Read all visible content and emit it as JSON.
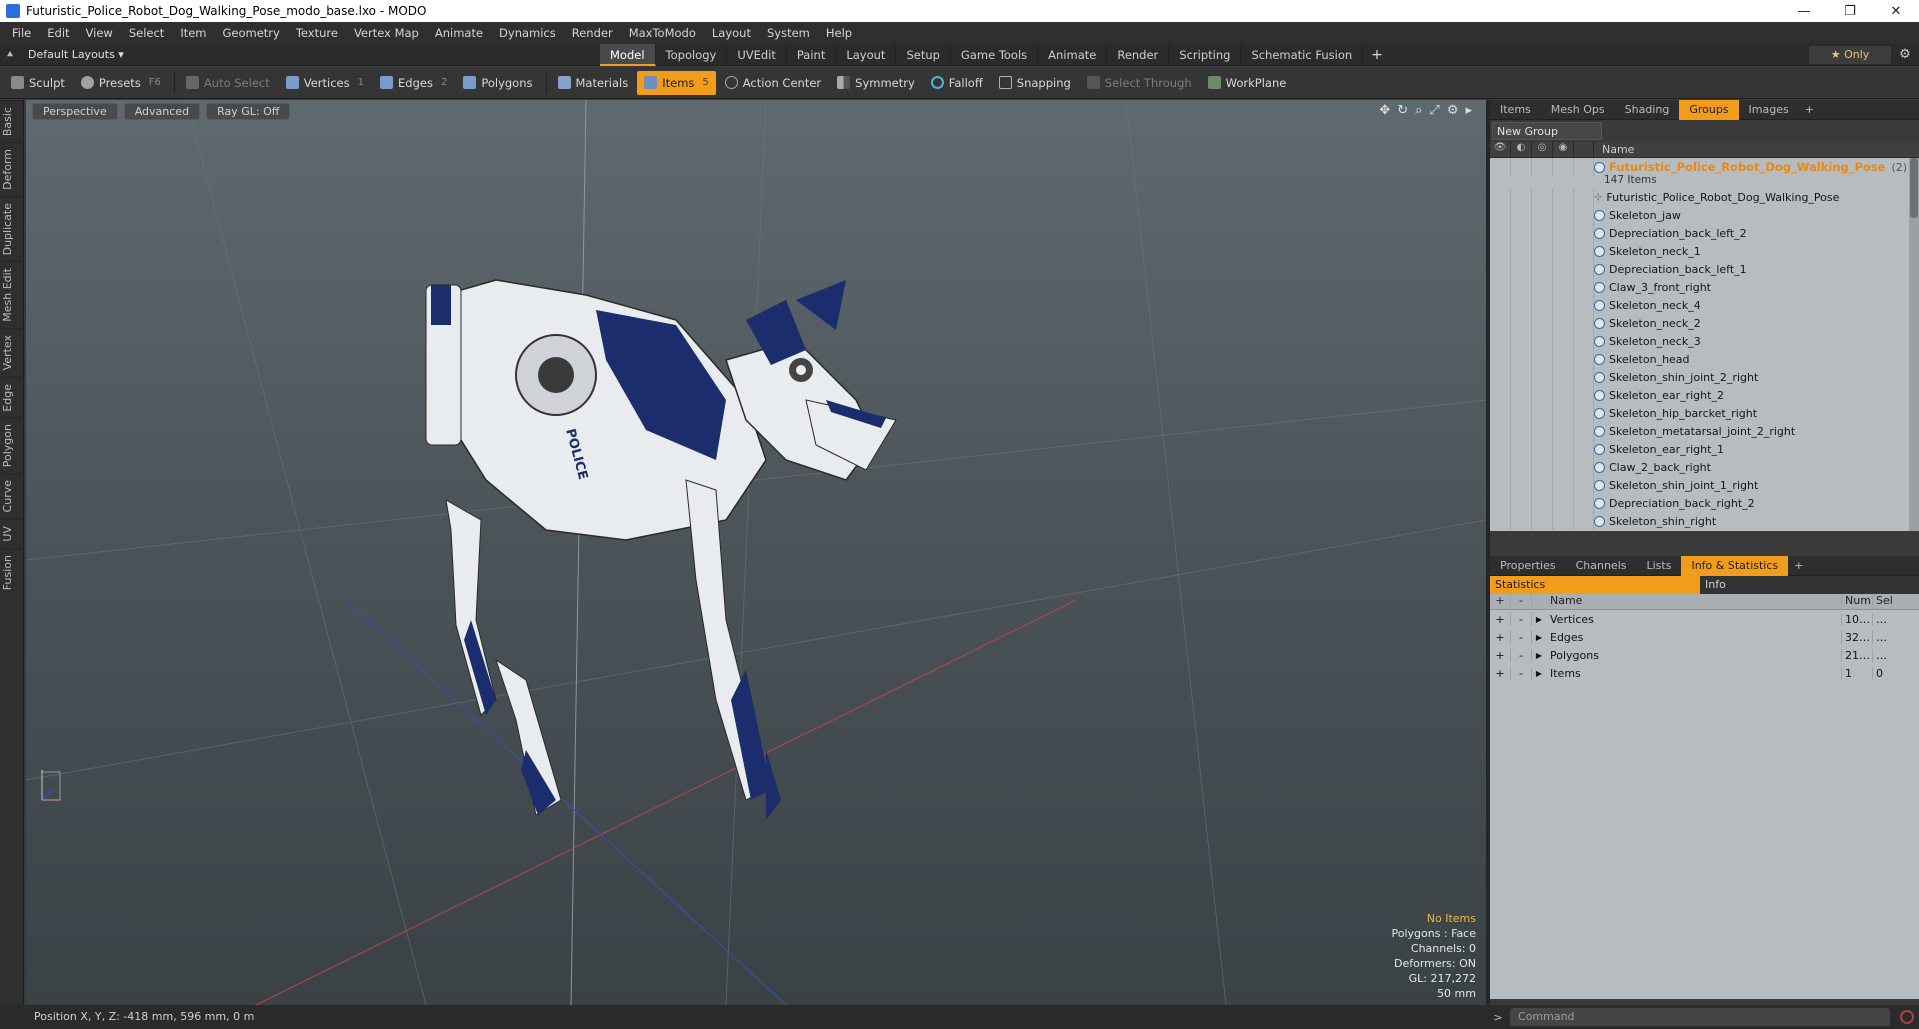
{
  "window": {
    "title": "Futuristic_Police_Robot_Dog_Walking_Pose_modo_base.lxo - MODO",
    "minimize": "—",
    "maximize": "❐",
    "close": "✕"
  },
  "menu": [
    "File",
    "Edit",
    "View",
    "Select",
    "Item",
    "Geometry",
    "Texture",
    "Vertex Map",
    "Animate",
    "Dynamics",
    "Render",
    "MaxToModo",
    "Layout",
    "System",
    "Help"
  ],
  "layout": {
    "selector": "Default Layouts ▾",
    "tabs": [
      "Model",
      "Topology",
      "UVEdit",
      "Paint",
      "Layout",
      "Setup",
      "Game Tools",
      "Animate",
      "Render",
      "Scripting",
      "Schematic Fusion"
    ],
    "active_tab": "Model",
    "plus": "+",
    "only_label": "★  Only",
    "gear": "⚙"
  },
  "toolbar": {
    "sculpt": "Sculpt",
    "presets": "Presets",
    "presets_key": "F6",
    "auto_select": "Auto Select",
    "vertices": "Vertices",
    "vertices_key": "1",
    "edges": "Edges",
    "edges_key": "2",
    "polygons": "Polygons",
    "materials": "Materials",
    "items": "Items",
    "items_key": "5",
    "action_center": "Action Center",
    "symmetry": "Symmetry",
    "falloff": "Falloff",
    "snapping": "Snapping",
    "select_through": "Select Through",
    "workplane": "WorkPlane"
  },
  "left_tabs": [
    "Basic",
    "Deform",
    "Duplicate",
    "Mesh Edit",
    "Vertex",
    "Edge",
    "Polygon",
    "Curve",
    "UV",
    "Fusion"
  ],
  "viewport": {
    "perspective": "Perspective",
    "advanced": "Advanced",
    "raygl": "Ray GL: Off",
    "tools": [
      "✥",
      "↻",
      "⌕",
      "⤢",
      "⚙",
      "▸"
    ],
    "info": {
      "no_items": "No Items",
      "polygons": "Polygons : Face",
      "channels": "Channels: 0",
      "deformers": "Deformers: ON",
      "gl": "GL: 217,272",
      "focal": "50 mm"
    }
  },
  "items_panel": {
    "tabs": [
      "Items",
      "Mesh Ops",
      "Shading",
      "Groups",
      "Images"
    ],
    "active_tab": "Groups",
    "plus": "+",
    "new_group": "New Group",
    "name_header": "Name",
    "group_name": "Futuristic_Police_Robot_Dog_Walking_Pose",
    "group_count_badge": "(2)",
    "group_items": "147 Items",
    "rows": [
      "Futuristic_Police_Robot_Dog_Walking_Pose",
      "Skeleton_jaw",
      "Depreciation_back_left_2",
      "Skeleton_neck_1",
      "Depreciation_back_left_1",
      "Claw_3_front_right",
      "Skeleton_neck_4",
      "Skeleton_neck_2",
      "Skeleton_neck_3",
      "Skeleton_head",
      "Skeleton_shin_joint_2_right",
      "Skeleton_ear_right_2",
      "Skeleton_hip_barcket_right",
      "Skeleton_metatarsal_joint_2_right",
      "Skeleton_ear_right_1",
      "Claw_2_back_right",
      "Skeleton_shin_joint_1_right",
      "Depreciation_back_right_2",
      "Skeleton_shin_right"
    ]
  },
  "props_panel": {
    "tabs": [
      "Properties",
      "Channels",
      "Lists",
      "Info & Statistics"
    ],
    "active_tab": "Info & Statistics",
    "plus": "+",
    "sub_tabs": [
      "Statistics",
      "Info"
    ],
    "headers": {
      "name": "Name",
      "num": "Num",
      "sel": "Sel"
    },
    "rows": [
      {
        "name": "Vertices",
        "num": "10…",
        "sel": "…"
      },
      {
        "name": "Edges",
        "num": "32…",
        "sel": "…"
      },
      {
        "name": "Polygons",
        "num": "21…",
        "sel": "…"
      },
      {
        "name": "Items",
        "num": "1",
        "sel": "0"
      }
    ]
  },
  "status": {
    "position": "Position X, Y, Z:   -418 mm, 596 mm, 0 m"
  },
  "command": {
    "placeholder": "Command",
    "arrow": ">"
  },
  "colors": {
    "accent": "#f29c1c",
    "group_name": "#e88a10",
    "robot_blue": "#1c2d6e",
    "robot_white": "#e9ecef"
  }
}
